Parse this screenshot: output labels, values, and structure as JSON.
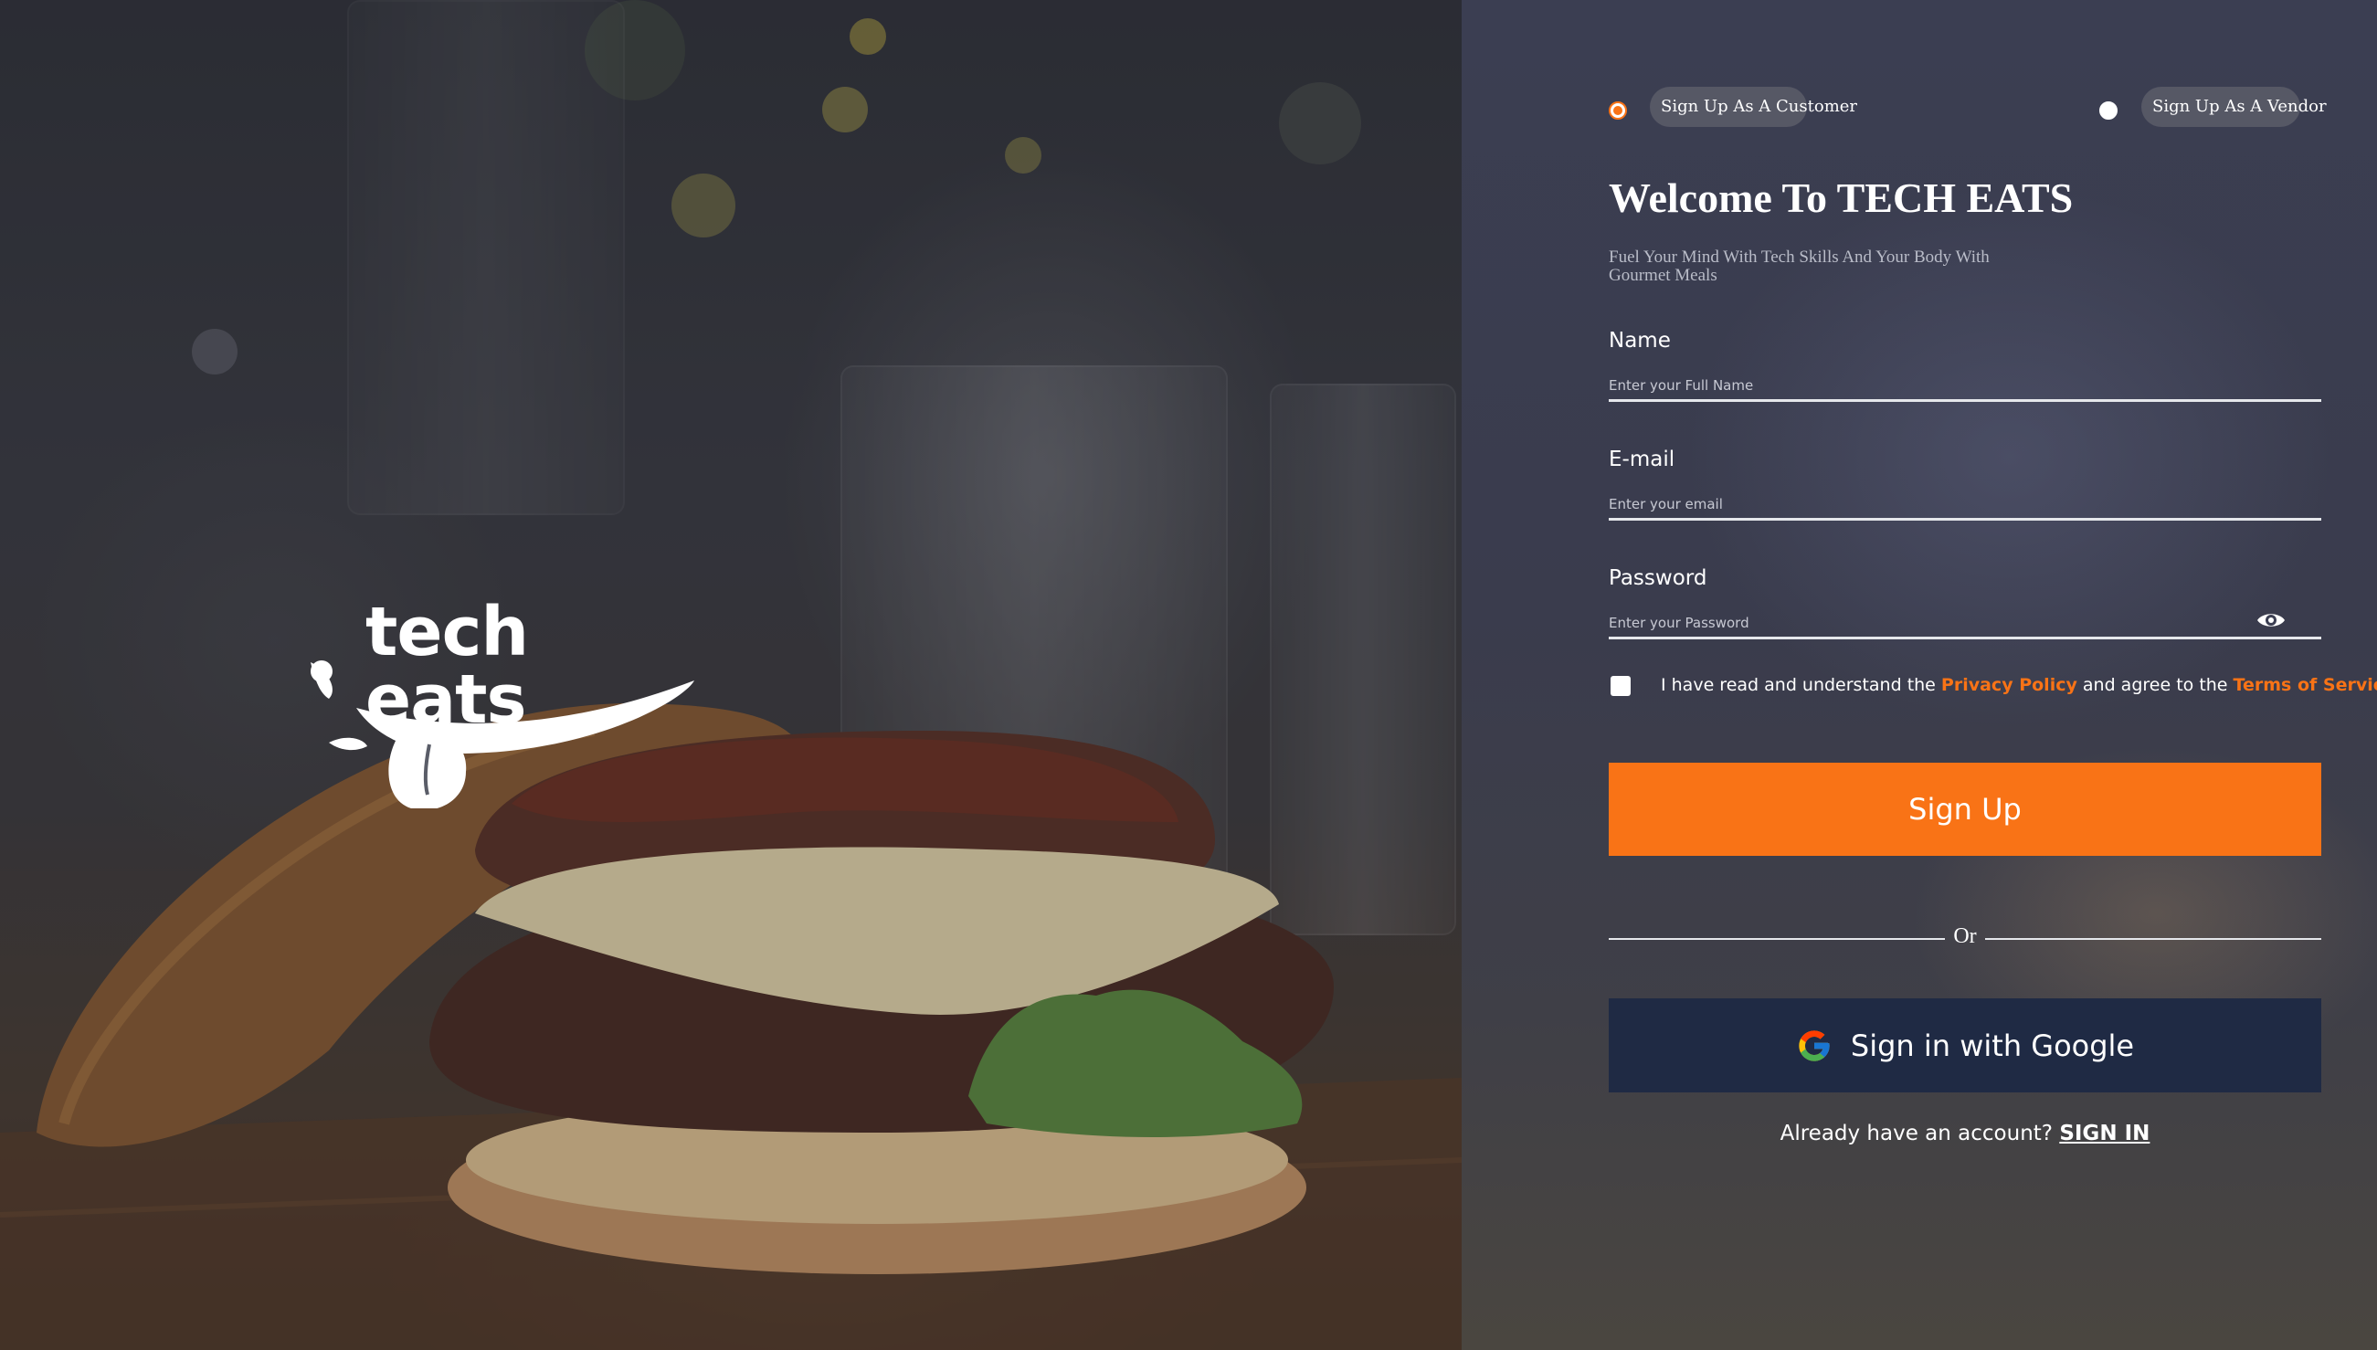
{
  "brand": {
    "logo_text": "tech eats"
  },
  "role_select": {
    "customer_label": "Sign Up As A Customer",
    "vendor_label": "Sign Up As A Vendor",
    "selected": "customer"
  },
  "welcome": {
    "title": "Welcome To TECH EATS",
    "subtitle": "Fuel Your Mind With Tech Skills And Your Body With Gourmet Meals"
  },
  "form": {
    "name": {
      "label": "Name",
      "placeholder": "Enter your Full Name",
      "value": ""
    },
    "email": {
      "label": "E-mail",
      "placeholder": "Enter your email",
      "value": ""
    },
    "password": {
      "label": "Password",
      "placeholder": "Enter your Password",
      "value": "",
      "toggle_icon": "eye-icon"
    }
  },
  "terms": {
    "prefix": "I have read and understand the ",
    "privacy_link": "Privacy Policy",
    "middle": " and agree to the ",
    "terms_link": "Terms of Service",
    "checked": false
  },
  "buttons": {
    "signup_label": "Sign Up",
    "or_label": "Or",
    "google_label": "Sign in with Google"
  },
  "signin": {
    "prompt": "Already have an account? ",
    "link_label": "SIGN IN"
  },
  "colors": {
    "accent": "#f97316",
    "google_button_bg": "#1f2a44",
    "panel_bg": "#3b3e52"
  }
}
